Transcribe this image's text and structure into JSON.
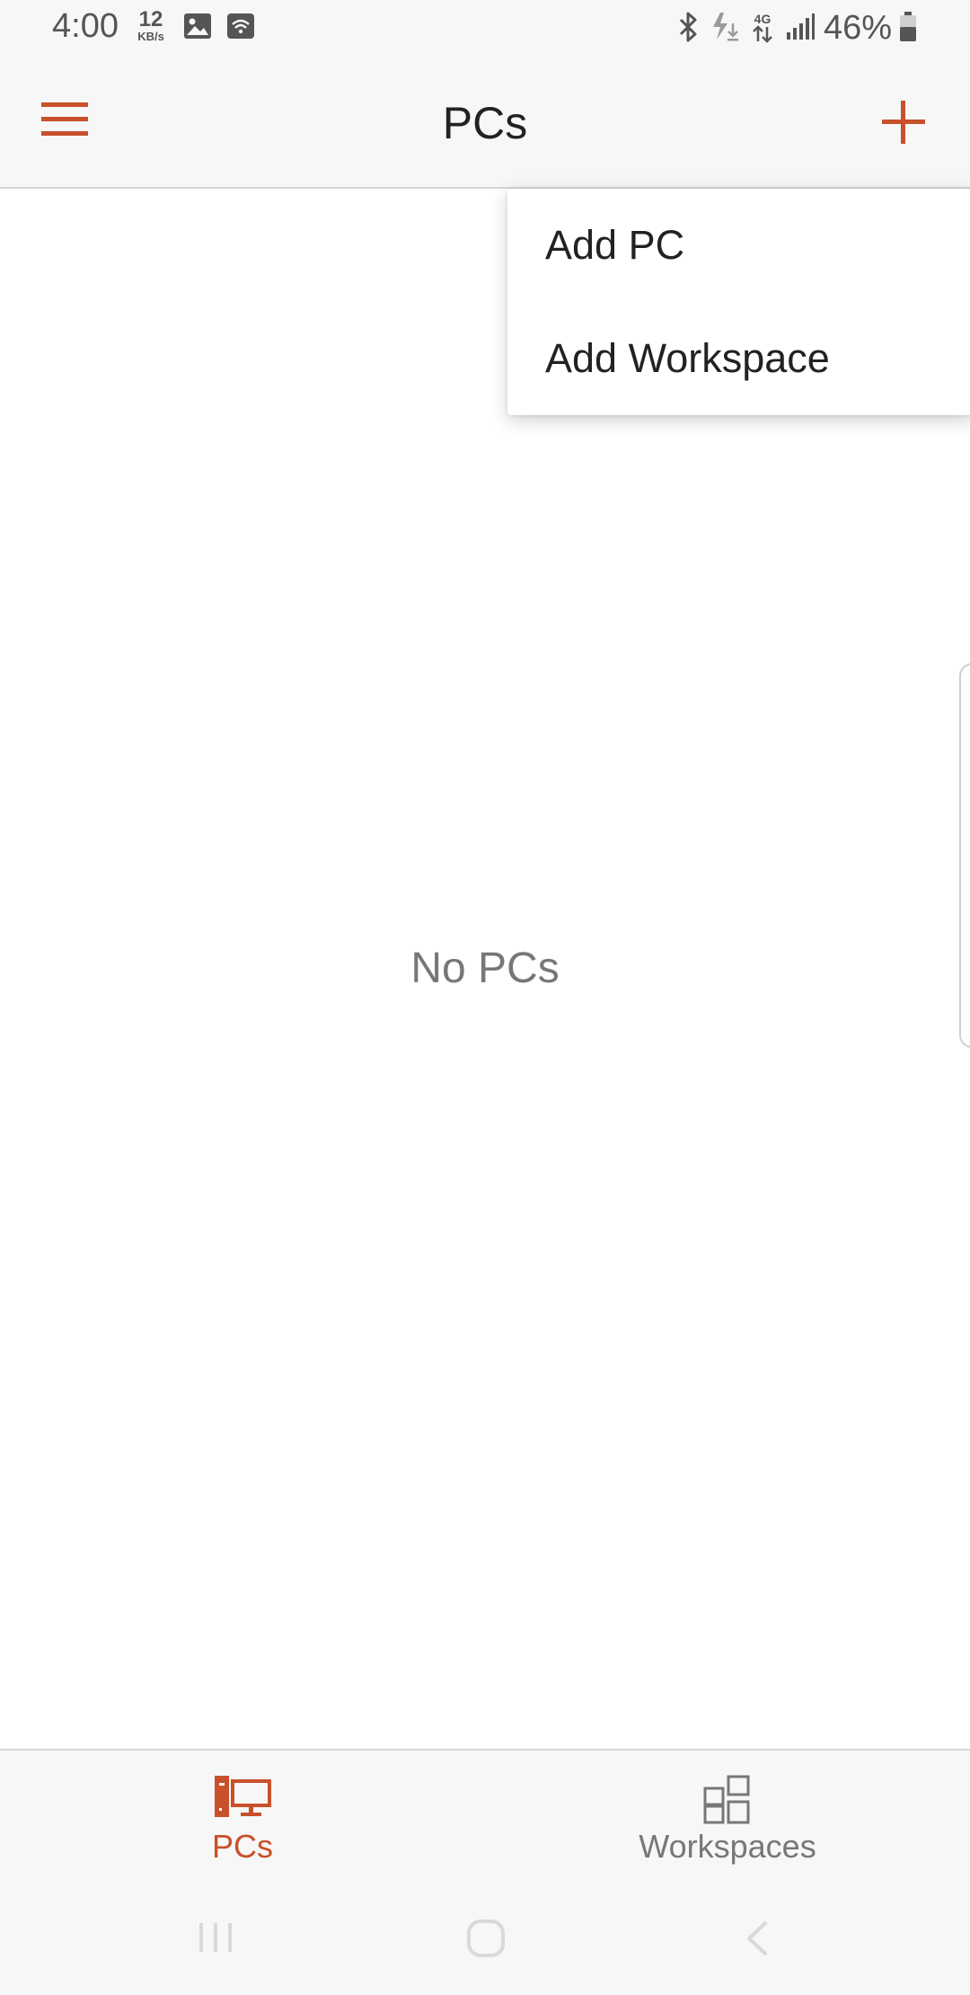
{
  "colors": {
    "accent": "#c8502b",
    "bar_background": "#f7f7f7",
    "text_primary": "#222222",
    "text_secondary": "#777777"
  },
  "status_bar": {
    "time": "4:00",
    "net_speed_value": "12",
    "net_speed_unit": "KB/s",
    "battery_percent": "46%",
    "icons": [
      "gallery-icon",
      "wifi-hotspot-icon",
      "bluetooth-icon",
      "data-saver-icon",
      "4g-icon",
      "signal-icon",
      "battery-icon"
    ]
  },
  "app_bar": {
    "title": "PCs",
    "left_icon": "hamburger-menu-icon",
    "right_icon": "plus-icon"
  },
  "dropdown_menu": {
    "items": [
      {
        "label": "Add PC"
      },
      {
        "label": "Add Workspace"
      }
    ]
  },
  "main": {
    "empty_message": "No PCs"
  },
  "tabs": [
    {
      "label": "PCs",
      "icon": "pc-monitor-icon",
      "active": true
    },
    {
      "label": "Workspaces",
      "icon": "workspaces-grid-icon",
      "active": false
    }
  ],
  "system_nav": {
    "buttons": [
      "recents-icon",
      "home-icon",
      "back-icon"
    ]
  }
}
